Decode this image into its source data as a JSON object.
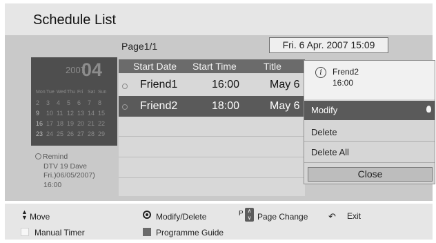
{
  "title": "Schedule List",
  "page_label": "Page1/1",
  "datetime": "Fri. 6 Apr. 2007 15:09",
  "calendar": {
    "year": "2007",
    "month": "04",
    "weekdays": [
      "Mon",
      "Tue",
      "Wed",
      "Thu",
      "Fri",
      "Sat",
      "Sun"
    ],
    "weeks": [
      [
        "2",
        "3",
        "4",
        "5",
        "6",
        "7",
        "8"
      ],
      [
        "9",
        "10",
        "11",
        "12",
        "13",
        "14",
        "15"
      ],
      [
        "16",
        "17",
        "18",
        "19",
        "20",
        "21",
        "22"
      ],
      [
        "23",
        "24",
        "25",
        "26",
        "27",
        "28",
        "29"
      ]
    ]
  },
  "remind": {
    "line1": "Remind",
    "line2": "DTV 19 Dave",
    "line3": "Fri.)06/05/2007)",
    "line4": "16:00"
  },
  "list": {
    "headers": {
      "start_date": "Start Date",
      "start_time": "Start Time",
      "title": "Title"
    },
    "rows": [
      {
        "name": "Friend1",
        "time": "16:00",
        "date": "May 6",
        "selected": false
      },
      {
        "name": "Friend2",
        "time": "18:00",
        "date": "May 6",
        "selected": true
      }
    ]
  },
  "popup": {
    "title": "Frend2",
    "time": "16:00",
    "items": [
      "Modify",
      "Delete",
      "Delete All"
    ],
    "close": "Close"
  },
  "footer": {
    "move": "Move",
    "modify_delete": "Modify/Delete",
    "page_change": "Page Change",
    "exit": "Exit",
    "manual_timer": "Manual Timer",
    "programme_guide": "Programme Guide",
    "p_glyph": "P"
  },
  "colors": {
    "panel": "#c9c9c9",
    "header": "#6b6b6b",
    "selected_row": "#5a5a5a",
    "popup_highlight": "#5a5a5a"
  },
  "icons": [
    "clock-icon",
    "info-icon",
    "ok-button-icon",
    "page-up-down-icon",
    "return-icon",
    "up-down-arrows-icon"
  ]
}
